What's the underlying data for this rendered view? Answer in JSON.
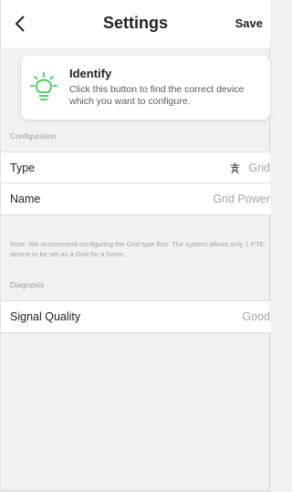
{
  "header": {
    "title": "Settings",
    "save_label": "Save"
  },
  "identify": {
    "title": "Identify",
    "description": "Click this button to find the correct device which you want to configure.",
    "icon": "lightbulb-icon",
    "accent_color": "#3dcd58"
  },
  "configuration": {
    "section_label": "Configuration",
    "rows": [
      {
        "label": "Type",
        "value": "Grid",
        "icon": "transmission-tower-icon"
      },
      {
        "label": "Name",
        "value": "Grid Power"
      }
    ],
    "note": "Note: We recommend configuring the Grid type first. The system allows only 1 PTE device to be set as a Grid for a home."
  },
  "diagnosis": {
    "section_label": "Diagnosis",
    "rows": [
      {
        "label": "Signal Quality",
        "value": "Good"
      }
    ]
  }
}
